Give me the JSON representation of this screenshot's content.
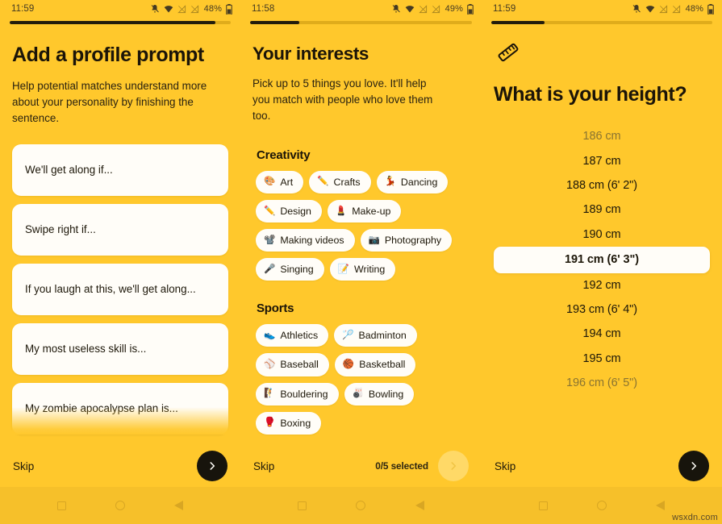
{
  "theme": {
    "background": "#ffc82c",
    "card": "#fffdf8",
    "ink": "#1b1408",
    "progress_fill": "#231c0c",
    "progress_track": "#e0ac1b",
    "navbar": "#f6c02a"
  },
  "watermark": "wsxdn.com",
  "screens": [
    {
      "id": "profile-prompt",
      "status": {
        "time": "11:59",
        "battery_pct": "48%",
        "icons": [
          "bell-muted-icon",
          "wifi-icon",
          "signal-off-icon",
          "signal-off-icon",
          "battery-icon"
        ]
      },
      "progress": 93,
      "title": "Add a profile prompt",
      "subtitle": "Help potential matches understand more about your personality by finishing the sentence.",
      "prompts": [
        "We'll get along if...",
        "Swipe right if...",
        "If you laugh at this, we'll get along...",
        "My most useless skill is...",
        "My zombie apocalypse plan is..."
      ],
      "footer": {
        "skip_label": "Skip",
        "next_icon": "chevron-right-icon",
        "next_enabled": true
      }
    },
    {
      "id": "interests",
      "status": {
        "time": "11:58",
        "battery_pct": "49%",
        "icons": [
          "bell-muted-icon",
          "wifi-icon",
          "signal-off-icon",
          "signal-off-icon",
          "battery-icon"
        ]
      },
      "progress": 22,
      "title": "Your interests",
      "subtitle": "Pick up to 5 things you love. It'll help you match with people who love them too.",
      "sections": [
        {
          "heading": "Creativity",
          "chips": [
            {
              "emoji": "🎨",
              "label": "Art"
            },
            {
              "emoji": "✏️",
              "label": "Crafts"
            },
            {
              "emoji": "💃",
              "label": "Dancing"
            },
            {
              "emoji": "✏️",
              "label": "Design"
            },
            {
              "emoji": "💄",
              "label": "Make-up"
            },
            {
              "emoji": "📽️",
              "label": "Making videos"
            },
            {
              "emoji": "📷",
              "label": "Photography"
            },
            {
              "emoji": "🎤",
              "label": "Singing"
            },
            {
              "emoji": "📝",
              "label": "Writing"
            }
          ]
        },
        {
          "heading": "Sports",
          "chips": [
            {
              "emoji": "👟",
              "label": "Athletics"
            },
            {
              "emoji": "🏸",
              "label": "Badminton"
            },
            {
              "emoji": "⚾",
              "label": "Baseball"
            },
            {
              "emoji": "🏀",
              "label": "Basketball"
            },
            {
              "emoji": "🧗",
              "label": "Bouldering"
            },
            {
              "emoji": "🎳",
              "label": "Bowling"
            },
            {
              "emoji": "🥊",
              "label": "Boxing"
            }
          ]
        }
      ],
      "footer": {
        "skip_label": "Skip",
        "count_label": "0/5 selected",
        "next_icon": "chevron-right-icon",
        "next_enabled": false
      }
    },
    {
      "id": "height",
      "status": {
        "time": "11:59",
        "battery_pct": "48%",
        "icons": [
          "bell-muted-icon",
          "wifi-icon",
          "signal-off-icon",
          "signal-off-icon",
          "battery-icon"
        ]
      },
      "progress": 24,
      "icon": "ruler-icon",
      "title": "What is your height?",
      "heights": [
        {
          "label": "186 cm",
          "state": "dim"
        },
        {
          "label": "187 cm",
          "state": "normal"
        },
        {
          "label": "188 cm (6' 2\")",
          "state": "normal"
        },
        {
          "label": "189 cm",
          "state": "normal"
        },
        {
          "label": "190 cm",
          "state": "normal"
        },
        {
          "label": "191 cm (6' 3\")",
          "state": "selected"
        },
        {
          "label": "192 cm",
          "state": "normal"
        },
        {
          "label": "193 cm (6' 4\")",
          "state": "normal"
        },
        {
          "label": "194 cm",
          "state": "normal"
        },
        {
          "label": "195 cm",
          "state": "normal"
        },
        {
          "label": "196 cm (6' 5\")",
          "state": "dim"
        }
      ],
      "footer": {
        "skip_label": "Skip",
        "next_icon": "chevron-right-icon",
        "next_enabled": true
      }
    }
  ]
}
